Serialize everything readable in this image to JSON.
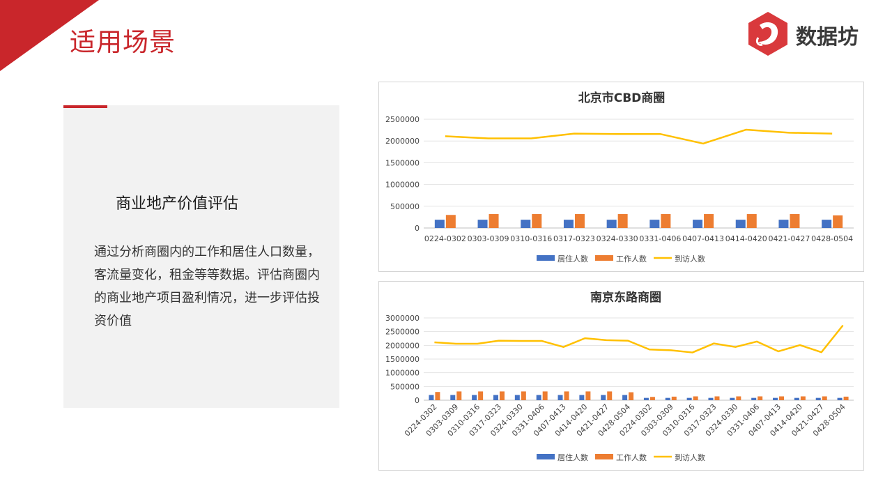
{
  "page": {
    "title": "适用场景",
    "logo_text": "数据坊"
  },
  "card": {
    "heading": "商业地产价值评估",
    "body": "通过分析商圈内的工作和居住人口数量，客流量变化，租金等等数据。评估商圈内的商业地产项目盈利情况，进一步评估投资价值"
  },
  "colors": {
    "accent": "#c9262b",
    "resident": "#4472c4",
    "worker": "#ed7d31",
    "visitor": "#ffc000"
  },
  "chart_data": [
    {
      "type": "bar",
      "title": "北京市CBD商圈",
      "categories": [
        "0224-0302",
        "0303-0309",
        "0310-0316",
        "0317-0323",
        "0324-0330",
        "0331-0406",
        "0407-0413",
        "0414-0420",
        "0421-0427",
        "0428-0504"
      ],
      "series": [
        {
          "name": "居住人数",
          "type": "bar",
          "values": [
            190000,
            190000,
            190000,
            190000,
            190000,
            190000,
            190000,
            190000,
            190000,
            190000
          ]
        },
        {
          "name": "工作人数",
          "type": "bar",
          "values": [
            300000,
            320000,
            320000,
            320000,
            320000,
            320000,
            320000,
            320000,
            320000,
            290000
          ]
        },
        {
          "name": "到访人数",
          "type": "line",
          "values": [
            2110000,
            2060000,
            2060000,
            2170000,
            2160000,
            2160000,
            1940000,
            2260000,
            2190000,
            2170000
          ]
        }
      ],
      "ylim": [
        0,
        2500000
      ],
      "yticks": [
        0,
        500000,
        1000000,
        1500000,
        2000000,
        2500000
      ],
      "grid": true,
      "legend": "bottom"
    },
    {
      "type": "bar",
      "title": "南京东路商圈",
      "categories": [
        "0224-0302",
        "0303-0309",
        "0310-0316",
        "0317-0323",
        "0324-0330",
        "0331-0406",
        "0407-0413",
        "0414-0420",
        "0421-0427",
        "0428-0504",
        "0224-0302",
        "0303-0309",
        "0310-0316",
        "0317-0323",
        "0324-0330",
        "0331-0406",
        "0407-0413",
        "0414-0420",
        "0421-0427",
        "0428-0504"
      ],
      "series": [
        {
          "name": "居住人数",
          "type": "bar",
          "values": [
            190000,
            190000,
            190000,
            190000,
            190000,
            190000,
            190000,
            190000,
            190000,
            190000,
            85000,
            85000,
            85000,
            85000,
            85000,
            85000,
            85000,
            85000,
            85000,
            85000
          ]
        },
        {
          "name": "工作人数",
          "type": "bar",
          "values": [
            300000,
            320000,
            320000,
            320000,
            320000,
            320000,
            320000,
            320000,
            320000,
            290000,
            120000,
            130000,
            140000,
            140000,
            140000,
            140000,
            140000,
            140000,
            140000,
            130000
          ]
        },
        {
          "name": "到访人数",
          "type": "line",
          "values": [
            2110000,
            2060000,
            2060000,
            2170000,
            2160000,
            2160000,
            1940000,
            2260000,
            2190000,
            2170000,
            1850000,
            1820000,
            1740000,
            2070000,
            1940000,
            2140000,
            1780000,
            2010000,
            1750000,
            2730000
          ]
        }
      ],
      "ylim": [
        0,
        3000000
      ],
      "yticks": [
        0,
        500000,
        1000000,
        1500000,
        2000000,
        2500000,
        3000000
      ],
      "grid": true,
      "legend": "bottom"
    }
  ]
}
